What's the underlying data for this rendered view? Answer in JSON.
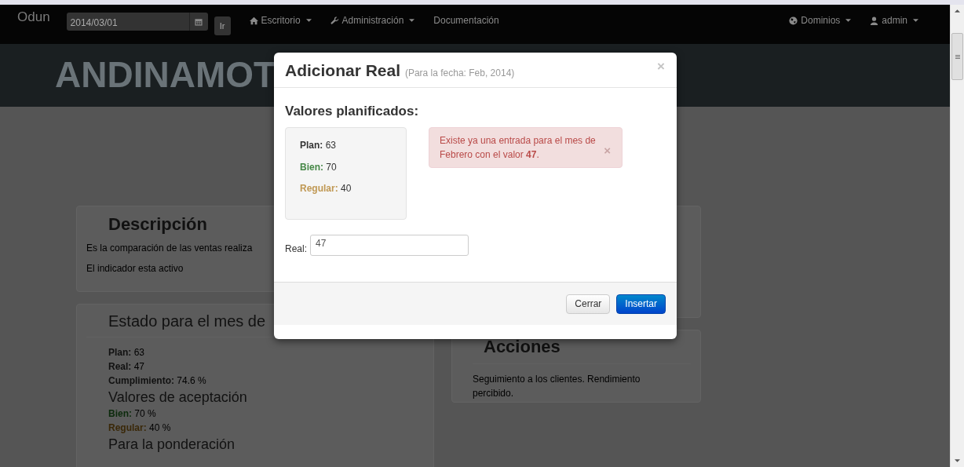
{
  "navbar": {
    "brand": "Odun",
    "date_field": {
      "value": "2014/03/01"
    },
    "go_button": "Ir",
    "menus": [
      {
        "label": "Escritorio",
        "kind": "dropdown"
      },
      {
        "label": "Administración",
        "kind": "dropdown"
      },
      {
        "label": "Documentación",
        "kind": "link"
      }
    ],
    "right_menus": [
      {
        "label": "Dominios",
        "kind": "dropdown"
      },
      {
        "label": "admin",
        "kind": "dropdown"
      }
    ]
  },
  "banner": {
    "title": "ANDINAMOT"
  },
  "description_card": {
    "heading": "Descripción",
    "lines": [
      "Es la comparación de las ventas realiza",
      "El indicador esta activo"
    ]
  },
  "status_card": {
    "heading": "Estado para el mes de",
    "values": [
      {
        "label": "Plan:",
        "value": "63",
        "color": "#111111"
      },
      {
        "label": "Real:",
        "value": "47",
        "color": "#111111"
      },
      {
        "label": "Cumplimiento:",
        "value": "74.6 %",
        "color": "#111111"
      }
    ],
    "acceptance_heading": "Valores de aceptación",
    "acceptance": [
      {
        "label": "Bien:",
        "value": "70 %",
        "color": "#0b2a0b"
      },
      {
        "label": "Regular:",
        "value": "40 %",
        "color": "#3a2808"
      }
    ],
    "weighting_heading": "Para la ponderación"
  },
  "actions_card": {
    "heading": "Acciones",
    "text": "Seguimiento a los clientes. Rendimiento percibido."
  },
  "modal": {
    "title": "Adicionar Real",
    "subtitle": "(Para la fecha: Feb, 2014)",
    "close": "×",
    "planned_heading": "Valores planificados:",
    "planned": [
      {
        "label": "Plan:",
        "value": "63",
        "color": "#333333"
      },
      {
        "label": "Bien:",
        "value": "70",
        "color": "#468847"
      },
      {
        "label": "Regular:",
        "value": "40",
        "color": "#c09853"
      }
    ],
    "alert": {
      "text": "Existe ya una entrada para el mes de Febrero con el valor **47**.",
      "close": "×"
    },
    "real_field": {
      "label": "Real:",
      "value": "47"
    },
    "buttons": [
      {
        "label": "Cerrar",
        "kind": "default"
      },
      {
        "label": "Insertar",
        "kind": "primary"
      }
    ]
  }
}
